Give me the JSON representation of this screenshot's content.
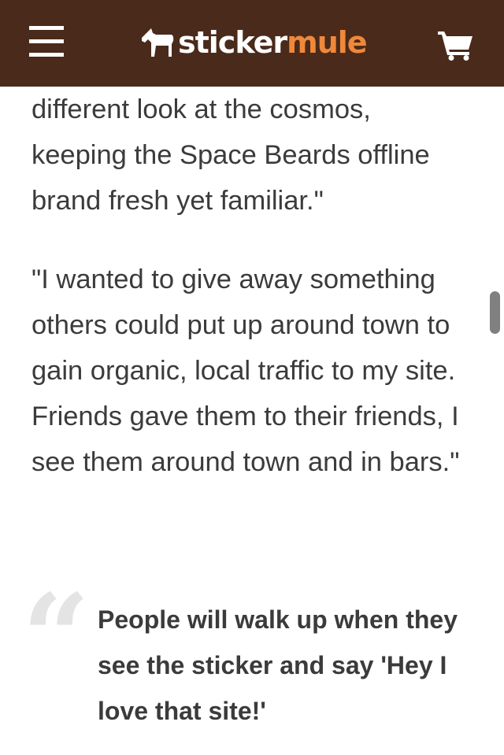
{
  "header": {
    "logo": {
      "part1": "sticker",
      "part2": "mule"
    },
    "menu_icon": "hamburger-menu-icon",
    "cart_icon": "shopping-cart-icon",
    "colors": {
      "background": "#4a2a1b",
      "logo_accent": "#f0883a",
      "icon": "#ffffff"
    }
  },
  "article": {
    "paragraph_1": "different look at the cosmos, keeping the Space Beards offline brand fresh yet familiar.\"",
    "paragraph_2": "\"I wanted to give away something others could put up around town to gain organic, local traffic to my site. Friends gave them to their friends, I see them around town and in bars.\"",
    "quote": "People will walk up when they see the sticker and say 'Hey I love that site!'"
  },
  "colors": {
    "text": "#3b3b3b",
    "quote_mark": "#e4e4e4"
  }
}
